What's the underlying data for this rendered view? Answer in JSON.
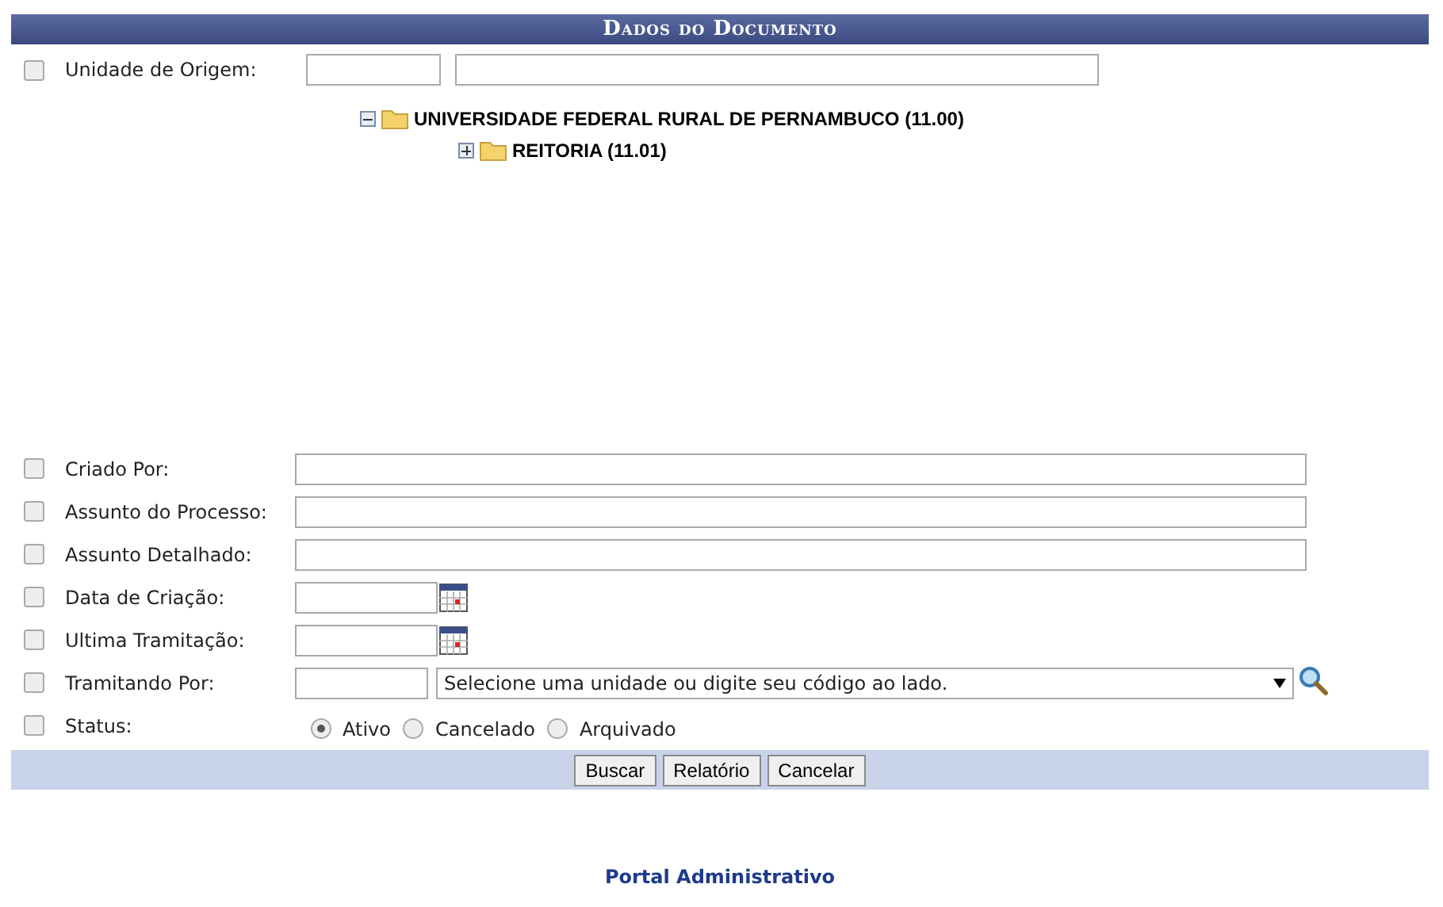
{
  "panel": {
    "title": "Dados do Documento"
  },
  "origin": {
    "checked": false,
    "label": "Unidade de Origem:",
    "tree": [
      {
        "label": "UNIVERSIDADE FEDERAL RURAL DE PERNAMBUCO (11.00)",
        "expanded": true,
        "children": [
          {
            "label": "REITORIA (11.01)",
            "expanded": false
          }
        ]
      }
    ]
  },
  "filters": [
    {
      "kind": "text",
      "checked": false,
      "label": "Criado Por:"
    },
    {
      "kind": "text",
      "checked": false,
      "label": "Assunto do Processo:"
    },
    {
      "kind": "text",
      "checked": false,
      "label": "Assunto Detalhado:"
    },
    {
      "kind": "date",
      "checked": false,
      "label": "Data de Criação:"
    },
    {
      "kind": "date",
      "checked": false,
      "label": "Ultima Tramitação:"
    },
    {
      "kind": "unit",
      "checked": false,
      "label": "Tramitando Por:",
      "select": "Selecione uma unidade ou digite seu código ao lado."
    },
    {
      "kind": "radio",
      "checked": false,
      "label": "Status:",
      "options": [
        {
          "label": "Ativo",
          "selected": true
        },
        {
          "label": "Cancelado",
          "selected": false
        },
        {
          "label": "Arquivado",
          "selected": false
        }
      ]
    }
  ],
  "buttons": [
    "Buscar",
    "Relatório",
    "Cancelar"
  ],
  "footer": "Portal Administrativo"
}
